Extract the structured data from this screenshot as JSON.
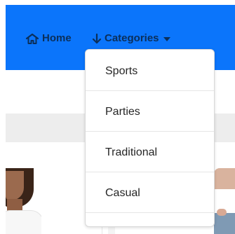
{
  "navbar": {
    "home": {
      "label": "Home",
      "icon": "home-icon"
    },
    "categories": {
      "label": "Categories",
      "icon": "arrow-down-icon",
      "caret_icon": "caret-down-icon"
    }
  },
  "dropdown": {
    "items": [
      {
        "label": "Sports"
      },
      {
        "label": "Parties"
      },
      {
        "label": "Traditional"
      },
      {
        "label": "Casual"
      }
    ]
  },
  "colors": {
    "navbar_background": "#0b75fb",
    "nav_text": "#0b2f5a",
    "menu_text": "#262626",
    "gray_bar": "#ededed"
  }
}
